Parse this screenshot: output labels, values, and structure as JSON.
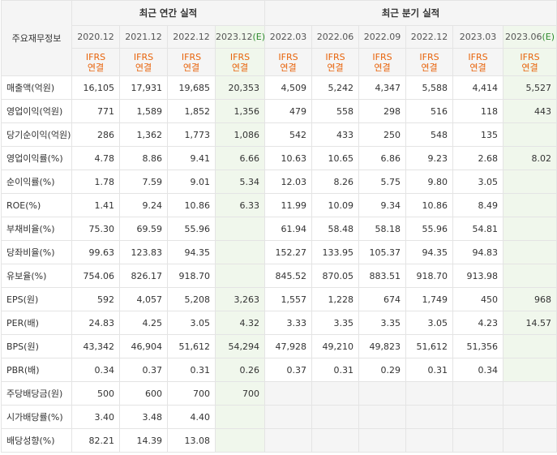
{
  "header": {
    "row_label": "주요재무정보",
    "annual_group": "최근 연간 실적",
    "quarterly_group": "최근 분기 실적",
    "periods": [
      "2020.12",
      "2021.12",
      "2022.12",
      "2023.12",
      "2022.03",
      "2022.06",
      "2022.09",
      "2022.12",
      "2023.03",
      "2023.06"
    ],
    "estimate_suffix": "(E)",
    "standard_line1": "IFRS",
    "standard_line2": "연결"
  },
  "rows": [
    {
      "label": "매출액(억원)",
      "values": [
        "16,105",
        "17,931",
        "19,685",
        "20,353",
        "4,509",
        "5,242",
        "4,347",
        "5,588",
        "4,414",
        "5,527"
      ]
    },
    {
      "label": "영업이익(억원)",
      "values": [
        "771",
        "1,589",
        "1,852",
        "1,356",
        "479",
        "558",
        "298",
        "516",
        "118",
        "443"
      ]
    },
    {
      "label": "당기순이익(억원)",
      "values": [
        "286",
        "1,362",
        "1,773",
        "1,086",
        "542",
        "433",
        "250",
        "548",
        "135",
        ""
      ]
    },
    {
      "label": "영업이익률(%)",
      "values": [
        "4.78",
        "8.86",
        "9.41",
        "6.66",
        "10.63",
        "10.65",
        "6.86",
        "9.23",
        "2.68",
        "8.02"
      ]
    },
    {
      "label": "순이익률(%)",
      "values": [
        "1.78",
        "7.59",
        "9.01",
        "5.34",
        "12.03",
        "8.26",
        "5.75",
        "9.80",
        "3.05",
        ""
      ]
    },
    {
      "label": "ROE(%)",
      "values": [
        "1.41",
        "9.24",
        "10.86",
        "6.33",
        "11.99",
        "10.09",
        "9.34",
        "10.86",
        "8.49",
        ""
      ]
    },
    {
      "label": "부채비율(%)",
      "values": [
        "75.30",
        "69.59",
        "55.96",
        "",
        "61.94",
        "58.48",
        "58.18",
        "55.96",
        "54.81",
        ""
      ]
    },
    {
      "label": "당좌비율(%)",
      "values": [
        "99.63",
        "123.83",
        "94.35",
        "",
        "152.27",
        "133.95",
        "105.37",
        "94.35",
        "94.83",
        ""
      ]
    },
    {
      "label": "유보율(%)",
      "values": [
        "754.06",
        "826.17",
        "918.70",
        "",
        "845.52",
        "870.05",
        "883.51",
        "918.70",
        "913.98",
        ""
      ]
    },
    {
      "label": "EPS(원)",
      "values": [
        "592",
        "4,057",
        "5,208",
        "3,263",
        "1,557",
        "1,228",
        "674",
        "1,749",
        "450",
        "968"
      ]
    },
    {
      "label": "PER(배)",
      "values": [
        "24.83",
        "4.25",
        "3.05",
        "4.32",
        "3.33",
        "3.35",
        "3.35",
        "3.05",
        "4.23",
        "14.57"
      ]
    },
    {
      "label": "BPS(원)",
      "values": [
        "43,342",
        "46,904",
        "51,612",
        "54,294",
        "47,928",
        "49,210",
        "49,823",
        "51,612",
        "51,356",
        ""
      ]
    },
    {
      "label": "PBR(배)",
      "values": [
        "0.34",
        "0.37",
        "0.31",
        "0.26",
        "0.37",
        "0.31",
        "0.29",
        "0.31",
        "0.34",
        ""
      ]
    },
    {
      "label": "주당배당금(원)",
      "values": [
        "500",
        "600",
        "700",
        "700",
        "",
        "",
        "",
        "",
        "",
        ""
      ]
    },
    {
      "label": "시가배당률(%)",
      "values": [
        "3.40",
        "3.48",
        "4.40",
        "",
        "",
        "",
        "",
        "",
        "",
        ""
      ]
    },
    {
      "label": "배당성향(%)",
      "values": [
        "82.21",
        "14.39",
        "13.08",
        "",
        "",
        "",
        "",
        "",
        "",
        ""
      ]
    }
  ]
}
